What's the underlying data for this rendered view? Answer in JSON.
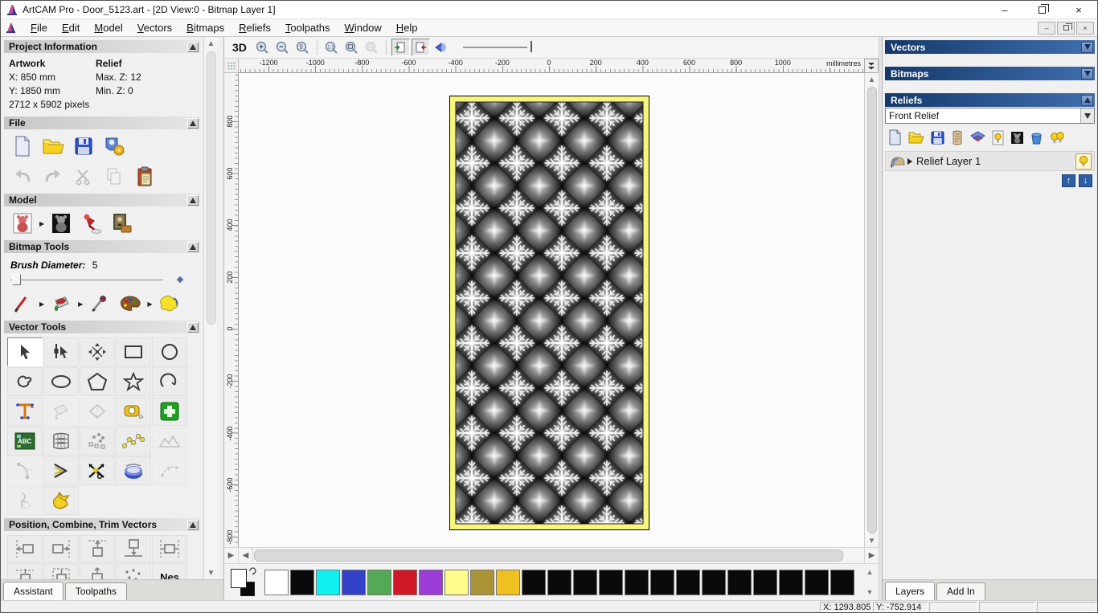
{
  "window": {
    "title": "ArtCAM Pro - Door_5123.art - [2D View:0 - Bitmap Layer 1]"
  },
  "menu": [
    "File",
    "Edit",
    "Model",
    "Vectors",
    "Bitmaps",
    "Reliefs",
    "Toolpaths",
    "Window",
    "Help"
  ],
  "left": {
    "tabs": [
      "Assistant",
      "Toolpaths"
    ],
    "project": {
      "title": "Project Information",
      "artwork_label": "Artwork",
      "relief_label": "Relief",
      "x": "X: 850 mm",
      "y": "Y: 1850 mm",
      "pixels": "2712 x 5902 pixels",
      "max_z": "Max. Z: 12",
      "min_z": "Min. Z: 0"
    },
    "file": {
      "title": "File"
    },
    "model": {
      "title": "Model"
    },
    "bitmap": {
      "title": "Bitmap Tools",
      "brush_label": "Brush Diameter:",
      "brush_value": "5"
    },
    "vector": {
      "title": "Vector Tools"
    },
    "position": {
      "title": "Position, Combine, Trim Vectors",
      "nesting_label": "Nes"
    }
  },
  "canvas": {
    "toolbar": {
      "view3d": "3D"
    },
    "units": "millimetres",
    "hticks": [
      "-1200",
      "-1000",
      "-800",
      "-600",
      "-400",
      "-200",
      "0",
      "200",
      "400",
      "600",
      "800",
      "1000"
    ],
    "vticks": [
      "800",
      "600",
      "400",
      "200",
      "0",
      "-200",
      "-400",
      "-600",
      "-800"
    ]
  },
  "palette": {
    "colors": [
      "#ffffff",
      "#0a0a0a",
      "#10f0f0",
      "#3340c8",
      "#55a855",
      "#d01828",
      "#9b3bd8",
      "#fffc8a",
      "#ab9435",
      "#f0c020",
      "#0a0a0a",
      "#0a0a0a",
      "#0a0a0a",
      "#0a0a0a",
      "#0a0a0a",
      "#0a0a0a",
      "#0a0a0a",
      "#0a0a0a",
      "#0a0a0a",
      "#0a0a0a",
      "#0a0a0a",
      "#0a0a0a",
      "#0a0a0a"
    ]
  },
  "right": {
    "vectors_title": "Vectors",
    "bitmaps_title": "Bitmaps",
    "reliefs_title": "Reliefs",
    "relief_dropdown": "Front Relief",
    "layer_name": "Relief Layer 1",
    "tabs": [
      "Layers",
      "Add In"
    ]
  },
  "status": {
    "x": "X: 1293.805",
    "y": "Y: -752.914"
  }
}
